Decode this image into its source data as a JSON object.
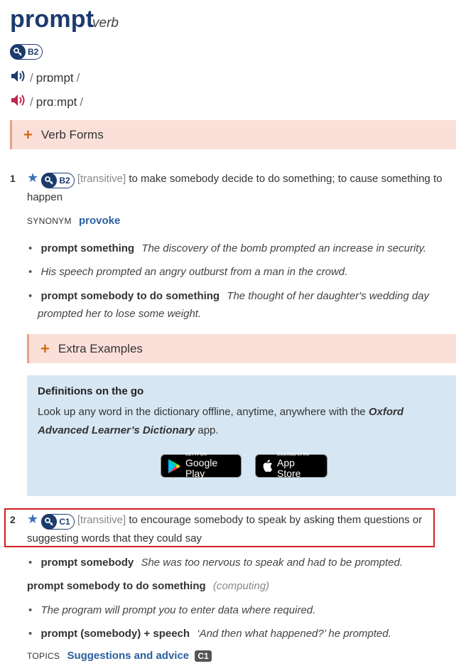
{
  "entry": {
    "headword": "prompt",
    "pos": "verb",
    "level": "B2",
    "pron_uk": "prɒmpt",
    "pron_us": "prɑːmpt"
  },
  "verb_forms": {
    "label": "Verb Forms"
  },
  "sense1": {
    "num": "1",
    "level": "B2",
    "grammar": "[transitive]",
    "def_line1": "to make somebody decide to do something; to cause something to",
    "def_line2": "happen",
    "synonym_label": "SYNONYM",
    "synonym": "provoke",
    "examples": [
      {
        "cf": "prompt something",
        "text": "The discovery of the bomb prompted an increase in security."
      },
      {
        "cf": "",
        "text": "His speech prompted an angry outburst from a man in the crowd."
      },
      {
        "cf": "prompt somebody to do something",
        "text": "The thought of her daughter's wedding day",
        "text2": "prompted her to lose some weight."
      }
    ],
    "extra_examples_label": "Extra Examples"
  },
  "promo": {
    "title": "Definitions on the go",
    "text_line1_a": "Look up any word in the dictionary offline, anytime, anywhere with the ",
    "text_line1_b": "Oxford",
    "text_line2_a": "Advanced Learner’s Dictionary",
    "text_line2_b": " app.",
    "google_small": "GET IT ON",
    "google_big": "Google Play",
    "apple_small": "Download on the",
    "apple_big": "App Store"
  },
  "sense2": {
    "num": "2",
    "level": "C1",
    "grammar": "[transitive]",
    "def_line1": "to encourage somebody to speak by asking them questions or",
    "def_line2": "suggesting words that they could say",
    "ex1_cf": "prompt somebody",
    "ex1_text": "She was too nervous to speak and had to be prompted.",
    "cf2": "prompt somebody to do something",
    "cf2_label": "(computing)",
    "ex2_text": "The program will prompt you to enter data where required.",
    "ex3_cf": "prompt (somebody) + speech",
    "ex3_text": "‘And then what happened?’ he prompted.",
    "topics_label": "TOPICS",
    "topics_word": "Suggestions and advice",
    "topics_level": "C1"
  },
  "colors": {
    "headword": "#1c3b6d",
    "link": "#2a5f9e",
    "panel_bg": "#fbe0d9",
    "plus": "#d66a14",
    "promo_bg": "#d6e6f3",
    "uk_audio": "#1c3b6d",
    "us_audio": "#c0264f",
    "highlight": "#d51f1f"
  },
  "icons": {
    "level": "oxford-key-icon",
    "uk_audio": "speaker-blue-icon",
    "us_audio": "speaker-red-icon",
    "star": "star-icon",
    "plus": "plus-icon",
    "google": "google-play-icon",
    "apple": "apple-icon"
  }
}
